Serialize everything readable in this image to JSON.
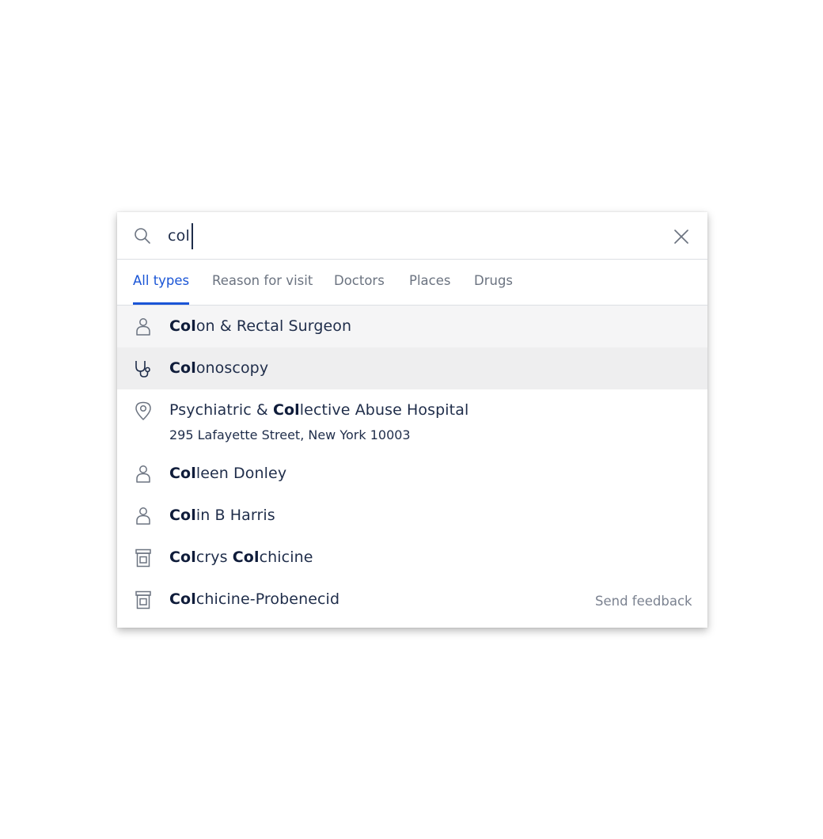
{
  "search": {
    "value": "col",
    "query_highlight": "Col"
  },
  "tabs": [
    {
      "label": "All types",
      "active": true
    },
    {
      "label": "Reason for visit",
      "active": false
    },
    {
      "label": "Doctors",
      "active": false
    },
    {
      "label": "Places",
      "active": false
    },
    {
      "label": "Drugs",
      "active": false
    }
  ],
  "results": [
    {
      "icon": "person-icon",
      "parts": [
        {
          "t": "Col",
          "b": true
        },
        {
          "t": "on & Rectal Surgeon",
          "b": false
        }
      ],
      "state": "hover"
    },
    {
      "icon": "stethoscope-icon",
      "parts": [
        {
          "t": "Col",
          "b": true
        },
        {
          "t": "onoscopy",
          "b": false
        }
      ],
      "state": "selected"
    },
    {
      "icon": "location-pin-icon",
      "parts": [
        {
          "t": "Psychiatric & ",
          "b": false
        },
        {
          "t": "Col",
          "b": true
        },
        {
          "t": "lective Abuse Hospital",
          "b": false
        }
      ],
      "sub": "295 Lafayette Street, New York 10003",
      "state": "normal"
    },
    {
      "icon": "person-icon",
      "parts": [
        {
          "t": "Col",
          "b": true
        },
        {
          "t": "leen Donley",
          "b": false
        }
      ],
      "state": "normal"
    },
    {
      "icon": "person-icon",
      "parts": [
        {
          "t": "Col",
          "b": true
        },
        {
          "t": "in B Harris",
          "b": false
        }
      ],
      "state": "normal"
    },
    {
      "icon": "pill-bottle-icon",
      "parts": [
        {
          "t": "Col",
          "b": true
        },
        {
          "t": "crys ",
          "b": false
        },
        {
          "t": "Col",
          "b": true
        },
        {
          "t": "chicine",
          "b": false
        }
      ],
      "state": "normal"
    },
    {
      "icon": "pill-bottle-icon",
      "parts": [
        {
          "t": "Col",
          "b": true
        },
        {
          "t": "chicine-Probenecid",
          "b": false
        }
      ],
      "state": "normal"
    }
  ],
  "footer": {
    "send_feedback_label": "Send feedback"
  },
  "colors": {
    "accent": "#1a55d6",
    "text": "#1f2d4a",
    "muted": "#6b7380",
    "hover_bg": "#f5f5f6",
    "selected_bg": "#eeeeef",
    "icon": "#6b7380"
  }
}
